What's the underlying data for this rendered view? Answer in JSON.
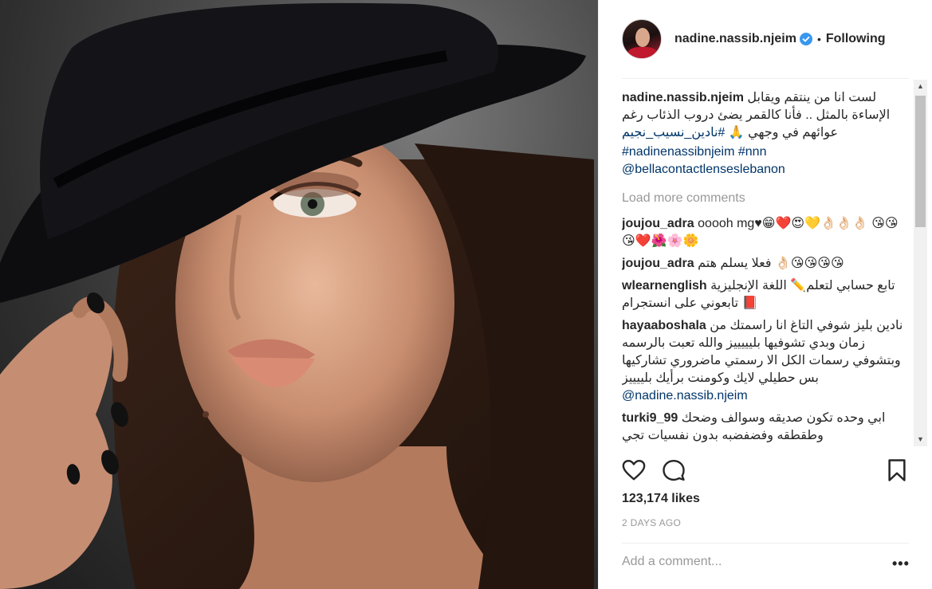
{
  "post": {
    "username": "nadine.nassib.njeim",
    "separator": "•",
    "follow_status": "Following",
    "caption": {
      "username": "nadine.nassib.njeim",
      "text": "لست انا من ينتقم ويقابل الإساءة بالمثل .. فأنا كالقمر يضئ دروب الذئاب رغم عوائهم في وجهي 🙏",
      "hashtag_ar": "#نادين_نسيب_نجيم",
      "hashtags": "#nadinenassibnjeim #nnn",
      "mention": "@bellacontactlenseslebanon"
    },
    "load_more": "Load more comments",
    "comments": [
      {
        "username": "joujou_adra",
        "text": "ooooh mg♥😁❤️😍💛👌🏻👌🏻👌🏻 😘😘😘❤️🌺🌸🌼"
      },
      {
        "username": "joujou_adra",
        "text": "فعلا يسلم هتم 👌🏻😘😘😘😘"
      },
      {
        "username": "wlearnenglish",
        "text": "تابع حسابي لتعلم✏️ اللغة الإنجليزية 📕 تابعوني على انستجرام"
      },
      {
        "username": "hayaaboshala",
        "text": "نادين بليز شوفي التاغ انا راسمتك من زمان وبدي تشوفيها بليييييز والله تعبت بالرسمه وبتشوفي رسمات الكل الا رسمتي ماضروري تشاركيها بس حطيلي لايك وكومنت برأيك بلييييز",
        "mention": "@nadine.nassib.njeim"
      },
      {
        "username": "turki9_99",
        "text": "ابي وحده تكون صديقه وسوالف وضحك وطقطقه وفضفضبه بدون نفسيات تجي"
      }
    ],
    "likes": "123,174 likes",
    "date": "2 DAYS AGO",
    "add_comment_placeholder": "Add a comment...",
    "more_options": "•••"
  },
  "icons": {
    "like": "heart-icon",
    "comment": "comment-icon",
    "save": "bookmark-icon",
    "verified": "verified-badge-icon",
    "more": "more-options-icon"
  },
  "colors": {
    "verified": "#3897f0",
    "link": "#003569",
    "muted": "#999999",
    "text": "#262626"
  }
}
